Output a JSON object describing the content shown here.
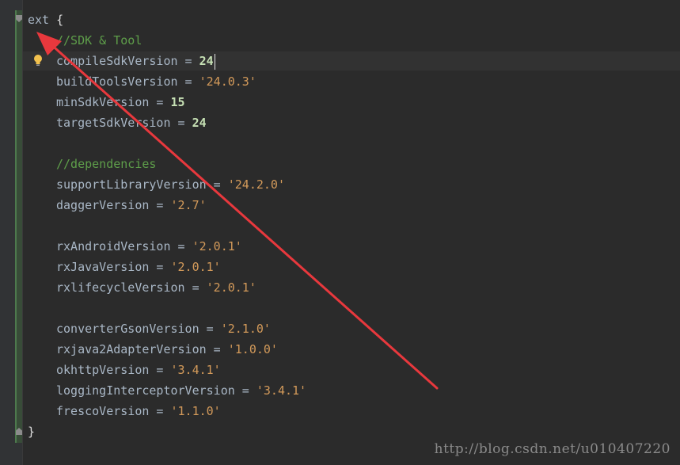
{
  "editor": {
    "lines": [
      {
        "indent": 0,
        "tokens": [
          {
            "type": "ident",
            "text": "ext "
          },
          {
            "type": "brace",
            "text": "{"
          }
        ]
      },
      {
        "indent": 1,
        "tokens": [
          {
            "type": "comment",
            "text": "//SDK & Tool"
          }
        ]
      },
      {
        "indent": 1,
        "caret": true,
        "tokens": [
          {
            "type": "ident",
            "text": "compileSdkVersion"
          },
          {
            "type": "op",
            "text": " = "
          },
          {
            "type": "num",
            "text": "24"
          }
        ]
      },
      {
        "indent": 1,
        "tokens": [
          {
            "type": "ident",
            "text": "buildToolsVersion"
          },
          {
            "type": "op",
            "text": " = "
          },
          {
            "type": "str",
            "text": "'24.0.3'"
          }
        ]
      },
      {
        "indent": 1,
        "tokens": [
          {
            "type": "ident",
            "text": "minSdkVersion"
          },
          {
            "type": "op",
            "text": " = "
          },
          {
            "type": "num",
            "text": "15"
          }
        ]
      },
      {
        "indent": 1,
        "tokens": [
          {
            "type": "ident",
            "text": "targetSdkVersion"
          },
          {
            "type": "op",
            "text": " = "
          },
          {
            "type": "num",
            "text": "24"
          }
        ]
      },
      {
        "indent": 0,
        "tokens": []
      },
      {
        "indent": 1,
        "tokens": [
          {
            "type": "comment",
            "text": "//dependencies"
          }
        ]
      },
      {
        "indent": 1,
        "tokens": [
          {
            "type": "ident",
            "text": "supportLibraryVersion"
          },
          {
            "type": "op",
            "text": " = "
          },
          {
            "type": "str",
            "text": "'24.2.0'"
          }
        ]
      },
      {
        "indent": 1,
        "tokens": [
          {
            "type": "ident",
            "text": "daggerVersion"
          },
          {
            "type": "op",
            "text": " = "
          },
          {
            "type": "str",
            "text": "'2.7'"
          }
        ]
      },
      {
        "indent": 0,
        "tokens": []
      },
      {
        "indent": 1,
        "tokens": [
          {
            "type": "ident",
            "text": "rxAndroidVersion"
          },
          {
            "type": "op",
            "text": " = "
          },
          {
            "type": "str",
            "text": "'2.0.1'"
          }
        ]
      },
      {
        "indent": 1,
        "tokens": [
          {
            "type": "ident",
            "text": "rxJavaVersion"
          },
          {
            "type": "op",
            "text": " = "
          },
          {
            "type": "str",
            "text": "'2.0.1'"
          }
        ]
      },
      {
        "indent": 1,
        "tokens": [
          {
            "type": "ident",
            "text": "rxlifecycleVersion"
          },
          {
            "type": "op",
            "text": " = "
          },
          {
            "type": "str",
            "text": "'2.0.1'"
          }
        ]
      },
      {
        "indent": 0,
        "tokens": []
      },
      {
        "indent": 1,
        "tokens": [
          {
            "type": "ident",
            "text": "converterGsonVersion"
          },
          {
            "type": "op",
            "text": " = "
          },
          {
            "type": "str",
            "text": "'2.1.0'"
          }
        ]
      },
      {
        "indent": 1,
        "tokens": [
          {
            "type": "ident",
            "text": "rxjava2AdapterVersion"
          },
          {
            "type": "op",
            "text": " = "
          },
          {
            "type": "str",
            "text": "'1.0.0'"
          }
        ]
      },
      {
        "indent": 1,
        "tokens": [
          {
            "type": "ident",
            "text": "okhttpVersion"
          },
          {
            "type": "op",
            "text": " = "
          },
          {
            "type": "str",
            "text": "'3.4.1'"
          }
        ]
      },
      {
        "indent": 1,
        "tokens": [
          {
            "type": "ident",
            "text": "loggingInterceptorVersion"
          },
          {
            "type": "op",
            "text": " = "
          },
          {
            "type": "str",
            "text": "'3.4.1'"
          }
        ]
      },
      {
        "indent": 1,
        "tokens": [
          {
            "type": "ident",
            "text": "frescoVersion"
          },
          {
            "type": "op",
            "text": " = "
          },
          {
            "type": "str",
            "text": "'1.1.0'"
          }
        ]
      },
      {
        "indent": 0,
        "tokens": [
          {
            "type": "brace",
            "text": "}"
          }
        ]
      }
    ]
  },
  "icons": {
    "intention_bulb": "lightbulb-icon",
    "fold_open": "fold-open-icon",
    "fold_close": "fold-close-icon"
  },
  "annotation": {
    "arrow_color": "#e8383d"
  },
  "colors": {
    "background": "#2b2b2b",
    "identifier": "#a9b7c6",
    "number": "#c6e0b4",
    "string": "#d39a5a",
    "comment": "#5e9e4a"
  },
  "watermark": {
    "text": "http://blog.csdn.net/u010407220"
  }
}
